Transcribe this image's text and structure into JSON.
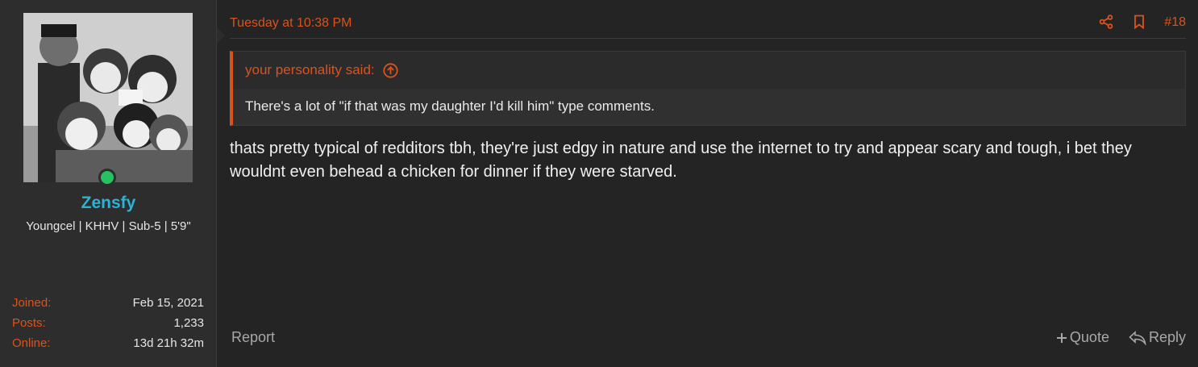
{
  "user": {
    "name": "Zensfy",
    "title": "Youngcel | KHHV | Sub-5 | 5'9\"",
    "avatar_icon": "avatar-image",
    "online": true,
    "online_color": "#27c160",
    "stats": [
      {
        "label": "Joined:",
        "value": "Feb 15, 2021"
      },
      {
        "label": "Posts:",
        "value": "1,233"
      },
      {
        "label": "Online:",
        "value": "13d 21h 32m"
      }
    ]
  },
  "post": {
    "date": "Tuesday at 10:38 PM",
    "number": "#18",
    "icons": [
      "share-icon",
      "bookmark-icon"
    ],
    "quote": {
      "author_line": "your personality said:",
      "text": "There's a lot of \"if that was my daughter I'd kill him\" type comments."
    },
    "message": "thats pretty typical of redditors tbh, they're just edgy in nature and use the internet to try and appear scary and tough, i bet they wouldnt even behead a chicken for dinner if they were starved.",
    "footer": {
      "report": "Report",
      "quote": "Quote",
      "reply": "Reply"
    }
  },
  "colors": {
    "accent": "#d9531e",
    "username": "#2ab3d6",
    "background": "#242424",
    "sidebar": "#2d2d2d"
  }
}
